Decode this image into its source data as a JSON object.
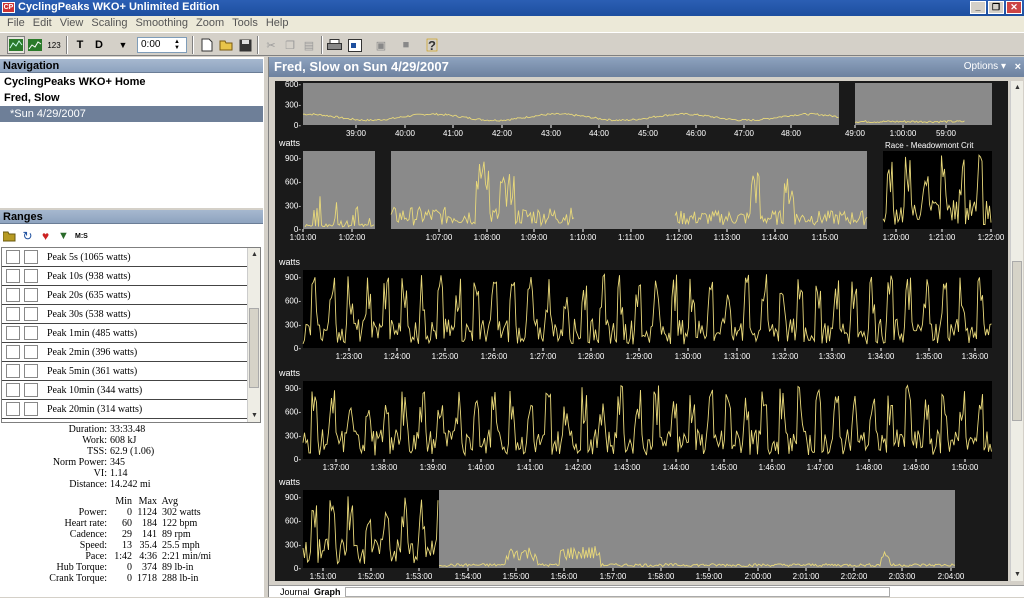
{
  "window": {
    "title": "CyclingPeaks WKO+ Unlimited Edition",
    "icon_label": "CP"
  },
  "menu": [
    "File",
    "Edit",
    "View",
    "Scaling",
    "Smoothing",
    "Zoom",
    "Tools",
    "Help"
  ],
  "toolbar": {
    "time_value": "0:00",
    "mode_label": "123",
    "t_label": "T",
    "d_label": "D"
  },
  "navigation": {
    "header": "Navigation",
    "items": [
      "CyclingPeaks WKO+ Home",
      "Fred, Slow",
      "*Sun 4/29/2007"
    ]
  },
  "ranges": {
    "header": "Ranges",
    "ms_label": "M:S",
    "items": [
      "Peak 5s (1065 watts)",
      "Peak 10s (938 watts)",
      "Peak 20s (635 watts)",
      "Peak 30s (538 watts)",
      "Peak 1min (485 watts)",
      "Peak 2min (396 watts)",
      "Peak 5min (361 watts)",
      "Peak 10min (344 watts)",
      "Peak 20min (314 watts)"
    ]
  },
  "summary": [
    {
      "label": "Duration:",
      "value": "33:33.48"
    },
    {
      "label": "Work:",
      "value": "608 kJ"
    },
    {
      "label": "TSS:",
      "value": "62.9 (1.06)"
    },
    {
      "label": "Norm Power:",
      "value": "345"
    },
    {
      "label": "VI:",
      "value": "1.14"
    },
    {
      "label": "Distance:",
      "value": "14.242 mi"
    }
  ],
  "stats_table": {
    "headers": [
      "Min",
      "Max",
      "Avg"
    ],
    "rows": [
      {
        "label": "Power:",
        "min": "0",
        "max": "1124",
        "avg": "302 watts"
      },
      {
        "label": "Heart rate:",
        "min": "60",
        "max": "184",
        "avg": "122 bpm"
      },
      {
        "label": "Cadence:",
        "min": "29",
        "max": "141",
        "avg": "89 rpm"
      },
      {
        "label": "Speed:",
        "min": "13",
        "max": "35.4",
        "avg": "25.5 mph"
      },
      {
        "label": "Pace:",
        "min": "1:42",
        "max": "4:36",
        "avg": "2:21 min/mi"
      },
      {
        "label": "Hub Torque:",
        "min": "0",
        "max": "374",
        "avg": "89 lb-in"
      },
      {
        "label": "Crank Torque:",
        "min": "0",
        "max": "1718",
        "avg": "288 lb-in"
      }
    ]
  },
  "main": {
    "title": "Fred, Slow on Sun 4/29/2007",
    "options_label": "Options",
    "close_label": "×"
  },
  "tabs": [
    "Journal",
    "Graph"
  ],
  "colors": {
    "trace": "#e8d87a",
    "grey_band": "#8a8a8a",
    "black_band": "#000000",
    "axis_text": "#ffffff"
  },
  "chart_data": [
    {
      "type": "line",
      "ylabel": "",
      "ytick_labels": [
        "0-",
        "300-",
        "600-"
      ],
      "xtick_labels": [
        "39:00",
        "40:00",
        "41:00",
        "42:00",
        "43:00",
        "44:00",
        "45:00",
        "46:00",
        "47:00",
        "48:00",
        "49:00",
        "59:00",
        "1:00:00"
      ],
      "annotation": ""
    },
    {
      "type": "line",
      "ylabel": "watts",
      "ytick_labels": [
        "0-",
        "300-",
        "600-",
        "900-"
      ],
      "xtick_labels": [
        "1:01:00",
        "1:02:00",
        "1:07:00",
        "1:08:00",
        "1:09:00",
        "1:10:00",
        "1:11:00",
        "1:12:00",
        "1:13:00",
        "1:14:00",
        "1:15:00",
        "1:20:00",
        "1:21:00",
        "1:22:00"
      ],
      "annotation": "Race - Meadowmont Crit"
    },
    {
      "type": "line",
      "ylabel": "watts",
      "ytick_labels": [
        "0-",
        "300-",
        "600-",
        "900-"
      ],
      "xtick_labels": [
        "1:23:00",
        "1:24:00",
        "1:25:00",
        "1:26:00",
        "1:27:00",
        "1:28:00",
        "1:29:00",
        "1:30:00",
        "1:31:00",
        "1:32:00",
        "1:33:00",
        "1:34:00",
        "1:35:00",
        "1:36:00"
      ]
    },
    {
      "type": "line",
      "ylabel": "watts",
      "ytick_labels": [
        "0-",
        "300-",
        "600-",
        "900-"
      ],
      "xtick_labels": [
        "1:37:00",
        "1:38:00",
        "1:39:00",
        "1:40:00",
        "1:41:00",
        "1:42:00",
        "1:43:00",
        "1:44:00",
        "1:45:00",
        "1:46:00",
        "1:47:00",
        "1:48:00",
        "1:49:00",
        "1:50:00"
      ]
    },
    {
      "type": "line",
      "ylabel": "watts",
      "ytick_labels": [
        "0-",
        "300-",
        "600-",
        "900-"
      ],
      "xtick_labels": [
        "1:51:00",
        "1:52:00",
        "1:53:00",
        "1:54:00",
        "1:55:00",
        "1:56:00",
        "1:57:00",
        "1:58:00",
        "1:59:00",
        "2:00:00",
        "2:01:00",
        "2:02:00",
        "2:03:00",
        "2:04:00"
      ]
    }
  ]
}
